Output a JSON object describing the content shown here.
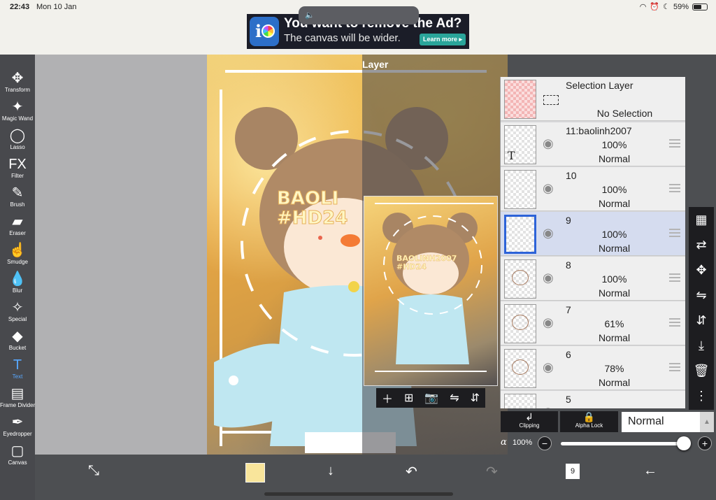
{
  "status_bar": {
    "time": "22:43",
    "date": "Mon 10 Jan",
    "battery": "59%",
    "battery_level": 0.59
  },
  "ad": {
    "headline": "You want to remove the Ad?",
    "subline": "The canvas will be wider.",
    "cta": "Learn more ▸"
  },
  "tools": [
    {
      "label": "Transform",
      "icon": "transform-icon",
      "glyph": "✥"
    },
    {
      "label": "Magic Wand",
      "icon": "magic-wand-icon",
      "glyph": "✦"
    },
    {
      "label": "Lasso",
      "icon": "lasso-icon",
      "glyph": "◯"
    },
    {
      "label": "Filter",
      "icon": "filter-icon",
      "glyph": "FX"
    },
    {
      "label": "Brush",
      "icon": "brush-icon",
      "glyph": "✎"
    },
    {
      "label": "Eraser",
      "icon": "eraser-icon",
      "glyph": "▰"
    },
    {
      "label": "Smudge",
      "icon": "smudge-icon",
      "glyph": "☝"
    },
    {
      "label": "Blur",
      "icon": "blur-icon",
      "glyph": "💧"
    },
    {
      "label": "Special",
      "icon": "special-icon",
      "glyph": "✧"
    },
    {
      "label": "Bucket",
      "icon": "bucket-icon",
      "glyph": "◆"
    },
    {
      "label": "Text",
      "icon": "text-icon",
      "glyph": "T"
    },
    {
      "label": "Frame Divider",
      "icon": "frame-divider-icon",
      "glyph": "▤"
    },
    {
      "label": "Eyedropper",
      "icon": "eyedropper-icon",
      "glyph": "✒"
    },
    {
      "label": "Canvas",
      "icon": "canvas-icon",
      "glyph": "▢"
    }
  ],
  "active_tool": "Text",
  "artwork": {
    "text_overlay": "BAOLI",
    "text_overlay_2": "#HD24",
    "preview_text": "BAOLINH2007",
    "preview_text_2": "#HD24"
  },
  "layer_panel": {
    "title": "Layer",
    "selection_layer": {
      "name": "Selection Layer",
      "status": "No Selection"
    },
    "layers": [
      {
        "name": "11:baolinh2007",
        "opacity": "100%",
        "blend": "Normal",
        "type": "text"
      },
      {
        "name": "10",
        "opacity": "100%",
        "blend": "Normal",
        "type": "empty"
      },
      {
        "name": "9",
        "opacity": "100%",
        "blend": "Normal",
        "type": "empty",
        "selected": true
      },
      {
        "name": "8",
        "opacity": "100%",
        "blend": "Normal",
        "type": "doodle"
      },
      {
        "name": "7",
        "opacity": "61%",
        "blend": "Normal",
        "type": "doodle"
      },
      {
        "name": "6",
        "opacity": "78%",
        "blend": "Normal",
        "type": "doodle"
      },
      {
        "name": "5",
        "opacity": "",
        "blend": "",
        "type": "empty"
      }
    ],
    "clipping_label": "Clipping",
    "alpha_lock_label": "Alpha Lock",
    "blend_mode": "Normal",
    "alpha_symbol": "α",
    "alpha_value": "100%",
    "alpha_level": 1.0
  },
  "bottom_bar": {
    "layer_count": "9",
    "color": "#f9e59b"
  }
}
